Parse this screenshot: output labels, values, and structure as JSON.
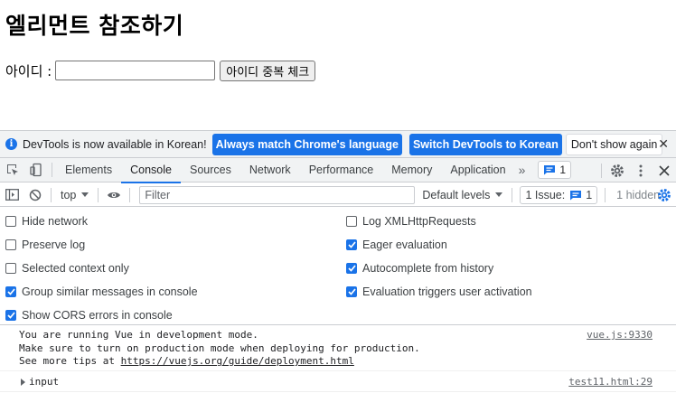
{
  "page": {
    "title": "엘리먼트 참조하기",
    "id_label": "아이디 :",
    "id_value": "",
    "check_button": "아이디 중복 체크"
  },
  "infobar": {
    "message": "DevTools is now available in Korean!",
    "btn_match": "Always match Chrome's language",
    "btn_switch": "Switch DevTools to Korean",
    "btn_dismiss": "Don't show again",
    "close": "✕"
  },
  "tabs": [
    "Elements",
    "Console",
    "Sources",
    "Network",
    "Performance",
    "Memory",
    "Application"
  ],
  "active_tab": "Console",
  "tabbar": {
    "more": "»",
    "issues_badge": "1"
  },
  "console_toolbar": {
    "context": "top",
    "filter_placeholder": "Filter",
    "levels": "Default levels",
    "issue_label": "1 Issue:",
    "issue_count": "1",
    "hidden": "1 hidden"
  },
  "settings": {
    "left": [
      {
        "label": "Hide network",
        "checked": false
      },
      {
        "label": "Preserve log",
        "checked": false
      },
      {
        "label": "Selected context only",
        "checked": false
      },
      {
        "label": "Group similar messages in console",
        "checked": true
      },
      {
        "label": "Show CORS errors in console",
        "checked": true
      }
    ],
    "right": [
      {
        "label": "Log XMLHttpRequests",
        "checked": false
      },
      {
        "label": "Eager evaluation",
        "checked": true
      },
      {
        "label": "Autocomplete from history",
        "checked": true
      },
      {
        "label": "Evaluation triggers user activation",
        "checked": true
      }
    ]
  },
  "messages": [
    {
      "line1": "You are running Vue in development mode.",
      "line2": "Make sure to turn on production mode when deploying for production.",
      "line3_prefix": "See more tips at ",
      "line3_link": "https://vuejs.org/guide/deployment.html",
      "source": "vue.js:9330"
    },
    {
      "text": "input",
      "source": "test11.html:29"
    }
  ],
  "colors": {
    "accent": "#1a73e8",
    "toolbar_bg": "#f1f3f4",
    "border": "#cacdd1"
  }
}
